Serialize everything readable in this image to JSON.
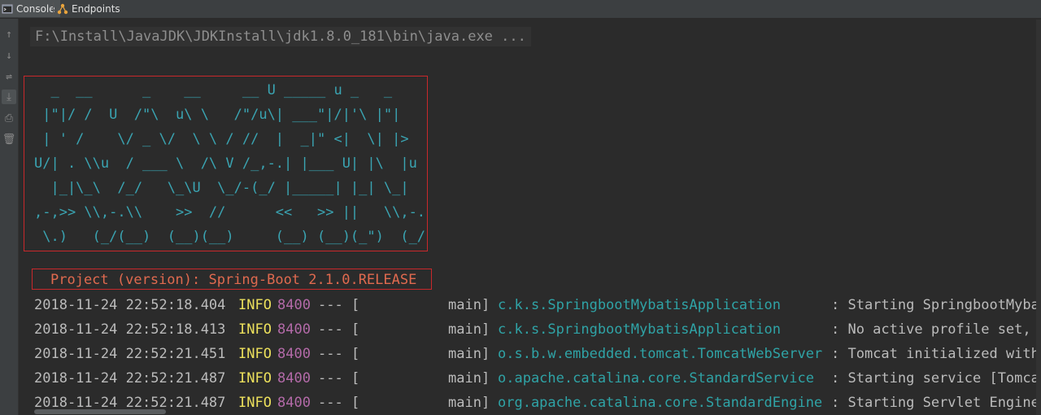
{
  "tabs": [
    {
      "label": "Console",
      "icon": "console-icon",
      "active": true
    },
    {
      "label": "Endpoints",
      "icon": "endpoints-icon",
      "active": false
    }
  ],
  "gutter": [
    {
      "icon": "arrow-up-icon",
      "glyph": "↑"
    },
    {
      "icon": "arrow-down-icon",
      "glyph": "↓"
    },
    {
      "icon": "soft-wrap-icon",
      "glyph": "⇌"
    },
    {
      "icon": "scroll-to-end-icon",
      "glyph": "⤓"
    },
    {
      "icon": "print-icon",
      "glyph": "⎙"
    },
    {
      "icon": "trash-icon",
      "glyph": "🗑"
    }
  ],
  "command": "F:\\Install\\JavaJDK\\JDKInstall\\jdk1.8.0_181\\bin\\java.exe ...",
  "banner": [
    "  _  __      _    __     __ U _____ u _   _",
    " |\"|/ /  U  /\"\\  u\\ \\   /\"/u\\| ___\"|/|'\\ |\"|",
    " | ' /    \\/ _ \\/  \\ \\ / //  |  _|\" <|  \\| |>",
    "U/| . \\\\u  / ___ \\  /\\ V /_,-.| |___ U| |\\  |u",
    "  |_|\\_\\  /_/   \\_\\U  \\_/-(_/ |_____| |_| \\_|",
    ",-,>> \\\\,-.\\\\    >>  //      <<   >> ||   \\\\,-.",
    " \\.)   (_/(__)  (__)(__)     (__) (__)(_\")  (_/"
  ],
  "version": "Project (version): Spring-Boot 2.1.0.RELEASE",
  "logs": [
    {
      "ts": "2018-11-24 22:52:18.404",
      "level": "INFO",
      "pid": "8400",
      "dash": "--- [",
      "thread": "main]",
      "logger": "c.k.s.SpringbootMybatisApplication",
      "msg": ": Starting SpringbootMybat"
    },
    {
      "ts": "2018-11-24 22:52:18.413",
      "level": "INFO",
      "pid": "8400",
      "dash": "--- [",
      "thread": "main]",
      "logger": "c.k.s.SpringbootMybatisApplication",
      "msg": ": No active profile set, f"
    },
    {
      "ts": "2018-11-24 22:52:21.451",
      "level": "INFO",
      "pid": "8400",
      "dash": "--- [",
      "thread": "main]",
      "logger": "o.s.b.w.embedded.tomcat.TomcatWebServer",
      "msg": ": Tomcat initialized with"
    },
    {
      "ts": "2018-11-24 22:52:21.487",
      "level": "INFO",
      "pid": "8400",
      "dash": "--- [",
      "thread": "main]",
      "logger": "o.apache.catalina.core.StandardService",
      "msg": ": Starting service [Tomcat"
    },
    {
      "ts": "2018-11-24 22:52:21.487",
      "level": "INFO",
      "pid": "8400",
      "dash": "--- [",
      "thread": "main]",
      "logger": "org.apache.catalina.core.StandardEngine",
      "msg": ": Starting Servlet Engine:"
    }
  ]
}
